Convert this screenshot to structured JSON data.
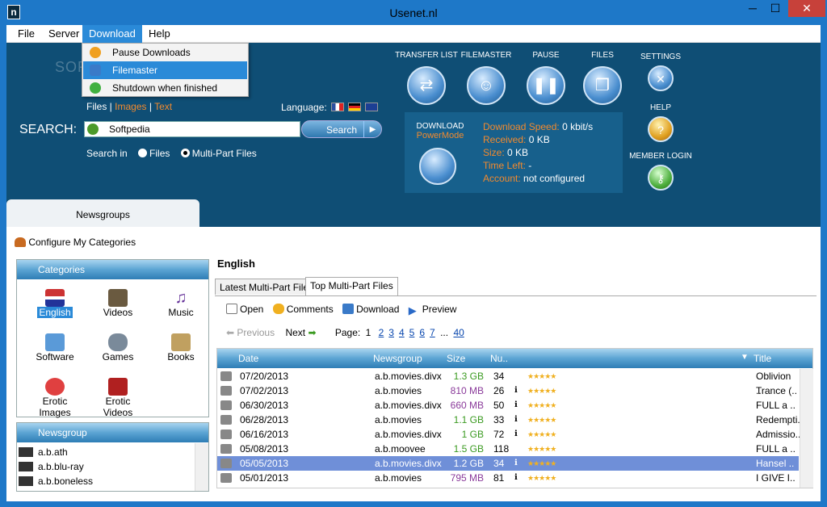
{
  "window": {
    "title": "Usenet.nl",
    "min": "─",
    "max": "☐",
    "close": "✕",
    "app_icon": "n"
  },
  "menu": {
    "file": "File",
    "server": "Server",
    "download": "Download",
    "help": "Help"
  },
  "dropdown": {
    "pause": "Pause Downloads",
    "filemaster": "Filemaster",
    "shutdown": "Shutdown when finished"
  },
  "watermark": "SOFTPEDIA",
  "links": {
    "files": "Files",
    "images": "Images",
    "text": "Text"
  },
  "language_label": "Language:",
  "search": {
    "label": "SEARCH:",
    "value": "Softpedia",
    "button": "Search",
    "arrow": "▶",
    "search_in": "Search in",
    "opt_files": "Files",
    "opt_multipart": "Multi-Part Files"
  },
  "toolbar_top": {
    "transfer": "TRANSFER LIST",
    "filemaster": "FILEMASTER",
    "pause": "PAUSE",
    "files": "FILES",
    "settings": "SETTINGS",
    "help": "HELP",
    "member": "MEMBER LOGIN"
  },
  "download": {
    "title": "DOWNLOAD",
    "powermode": "PowerMode",
    "speed_lbl": "Download Speed:",
    "speed": "0 kbit/s",
    "received_lbl": "Received:",
    "received": "0 KB",
    "size_lbl": "Size:",
    "size": "0 KB",
    "timeleft_lbl": "Time Left:",
    "timeleft": "-",
    "account_lbl": "Account:",
    "account": "not configured"
  },
  "newsgroups_tab": "Newsgroups",
  "configure": "Configure My Categories",
  "categories_title": "Categories",
  "categories": [
    "English",
    "Videos",
    "Music",
    "Software",
    "Games",
    "Books",
    "Erotic Images",
    "Erotic Videos"
  ],
  "newsgroup_title": "Newsgroup",
  "newsgroups": [
    "a.b.ath",
    "a.b.blu-ray",
    "a.b.boneless"
  ],
  "section_title": "English",
  "tabs": {
    "latest": "Latest Multi-Part Files",
    "top": "Top Multi-Part Files"
  },
  "tools": {
    "open": "Open",
    "comments": "Comments",
    "download": "Download",
    "preview": "Preview"
  },
  "pager": {
    "previous": "Previous",
    "next": "Next",
    "page": "Page:",
    "pages": [
      "1",
      "2",
      "3",
      "4",
      "5",
      "6",
      "7"
    ],
    "ellipsis": "...",
    "last": "40"
  },
  "grid_headers": {
    "date": "Date",
    "newsgroup": "Newsgroup",
    "size": "Size",
    "nu": "Nu..",
    "title": "Title"
  },
  "rows": [
    {
      "date": "07/20/2013",
      "ng": "a.b.movies.divx",
      "size": "1.3 GB",
      "n": "34",
      "title": "Oblivion ..",
      "c": "green"
    },
    {
      "date": "07/02/2013",
      "ng": "a.b.movies",
      "size": "810 MB",
      "n": "26",
      "title": "Trance (..",
      "c": "purple"
    },
    {
      "date": "06/30/2013",
      "ng": "a.b.movies.divx",
      "size": "660 MB",
      "n": "50",
      "title": "FULL a ..",
      "c": "purple"
    },
    {
      "date": "06/28/2013",
      "ng": "a.b.movies",
      "size": "1.1 GB",
      "n": "33",
      "title": "Redempti..",
      "c": "green"
    },
    {
      "date": "06/16/2013",
      "ng": "a.b.movies.divx",
      "size": "1 GB",
      "n": "72",
      "title": "Admissio..",
      "c": "green"
    },
    {
      "date": "05/08/2013",
      "ng": "a.b.moovee",
      "size": "1.5 GB",
      "n": "118",
      "title": "FULL a ..",
      "c": "green"
    },
    {
      "date": "05/05/2013",
      "ng": "a.b.movies.divx",
      "size": "1.2 GB",
      "n": "34",
      "title": "Hansel ..",
      "c": "green"
    },
    {
      "date": "05/01/2013",
      "ng": "a.b.movies",
      "size": "795 MB",
      "n": "81",
      "title": "I GIVE I..",
      "c": "purple"
    }
  ],
  "stars": "★★★★★"
}
